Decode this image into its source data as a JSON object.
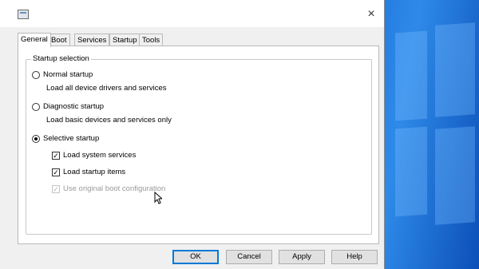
{
  "dialog": {
    "close_glyph": "×",
    "tabs": [
      {
        "label": "General",
        "active": true
      },
      {
        "label": "Boot"
      },
      {
        "label": "Services"
      },
      {
        "label": "Startup"
      },
      {
        "label": "Tools"
      }
    ],
    "startup_selection": {
      "legend": "Startup selection",
      "normal": {
        "label": "Normal startup",
        "desc": "Load all device drivers and services",
        "checked": false
      },
      "diagnostic": {
        "label": "Diagnostic startup",
        "desc": "Load basic devices and services only",
        "checked": false
      },
      "selective": {
        "label": "Selective startup",
        "checked": true
      },
      "load_system_services": {
        "label": "Load system services",
        "checked": true
      },
      "load_startup_items": {
        "label": "Load startup items",
        "checked": true
      },
      "use_original_boot": {
        "label": "Use original boot configuration",
        "checked": true,
        "disabled": true
      }
    },
    "buttons": {
      "ok": "OK",
      "cancel": "Cancel",
      "apply": "Apply",
      "help": "Help"
    }
  },
  "colors": {
    "accent": "#0078d7",
    "dialog_bg": "#f0f0f0",
    "desktop_blue": "#1467d4"
  }
}
